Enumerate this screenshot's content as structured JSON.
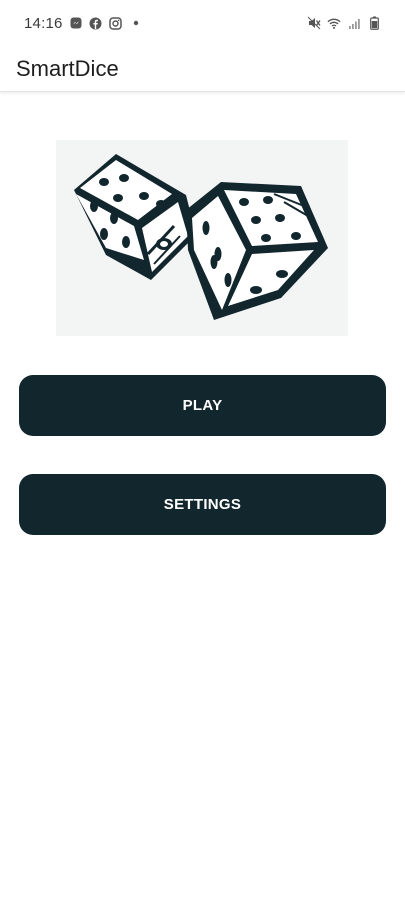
{
  "status_bar": {
    "time": "14:16",
    "left_icons": [
      "messenger-icon",
      "facebook-icon",
      "instagram-icon",
      "notification-dot-icon"
    ],
    "right_icons": [
      "mute-icon",
      "wifi-icon",
      "signal-icon",
      "battery-icon"
    ]
  },
  "app_bar": {
    "title": "SmartDice"
  },
  "hero": {
    "image": "dice-illustration"
  },
  "buttons": {
    "play_label": "PLAY",
    "settings_label": "SETTINGS"
  },
  "colors": {
    "button_bg": "#12262e",
    "button_text": "#ffffff",
    "background": "#ffffff"
  }
}
